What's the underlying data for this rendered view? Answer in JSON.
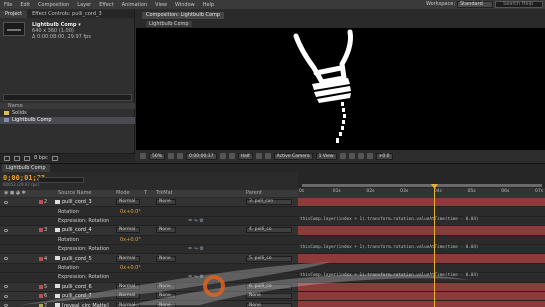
{
  "menu": [
    "File",
    "Edit",
    "Composition",
    "Layer",
    "Effect",
    "Animation",
    "View",
    "Window",
    "Help"
  ],
  "workspace": {
    "label": "Workspace:",
    "value": "Standard"
  },
  "search": {
    "placeholder": "Search Help"
  },
  "project": {
    "tabs": [
      "Project",
      "Effect Controls: pulli_cord_3"
    ],
    "item_title": "Lightbulb Comp ▾",
    "item_lines": [
      "640 x 360 (1.00)",
      "Δ 0:00:08:00, 29.97 fps"
    ],
    "header": "Name",
    "items": [
      {
        "name": "Solids",
        "color": "#d8c060"
      },
      {
        "name": "Lightbulb Comp",
        "color": "#8a8ab0"
      }
    ],
    "bpc": "8 bpc"
  },
  "viewer": {
    "tab": "Composition: Lightbulb Comp",
    "crumb": "Lightbulb Comp",
    "toolbar": [
      "50%",
      "0:00:00:17",
      "Half",
      "Active Camera",
      "1 View",
      "+0.0"
    ]
  },
  "timeline": {
    "tab": "Lightbulb Comp",
    "timecode": "0;00;01;23",
    "frames": "00053 (29.97 fps)",
    "columns": [
      "Source Name",
      "Mode",
      "T",
      "TrkMat",
      "Parent"
    ],
    "ruler": [
      "0s",
      "01s",
      "02s",
      "03s",
      "04s",
      "05s",
      "06s",
      "07s"
    ],
    "rows": [
      {
        "kind": "layer",
        "num": "2",
        "name": "pulli_cord_3",
        "mode": "Normal",
        "trk": "None",
        "parent": "3. pull_con",
        "label": "#c05050"
      },
      {
        "kind": "prop",
        "name": "Rotation",
        "value": "0x+0.0°"
      },
      {
        "kind": "expr",
        "name": "Expression: Rotation",
        "code": "thisComp.layer(index + 1).transform.rotation.valueAtTime(time - 0.04)"
      },
      {
        "kind": "layer",
        "num": "3",
        "name": "pulli_cord_4",
        "mode": "Normal",
        "trk": "None",
        "parent": "4. pulli_co",
        "label": "#c05050"
      },
      {
        "kind": "prop",
        "name": "Rotation",
        "value": "0x+0.0°"
      },
      {
        "kind": "expr",
        "name": "Expression: Rotation",
        "code": "thisComp.layer(index + 1).transform.rotation.valueAtTime(time - 0.04)"
      },
      {
        "kind": "layer",
        "num": "4",
        "name": "pulli_cord_5",
        "mode": "Normal",
        "trk": "None",
        "parent": "5. pulli_co",
        "label": "#c05050"
      },
      {
        "kind": "prop",
        "name": "Rotation",
        "value": "0x+0.0°"
      },
      {
        "kind": "expr",
        "name": "Expression: Rotation",
        "code": "thisComp.layer(index + 1).transform.rotation.valueAtTime(time - 0.04)"
      },
      {
        "kind": "layer",
        "num": "5",
        "name": "pulli_cord_6",
        "mode": "Normal",
        "trk": "None",
        "parent": "6. pulli_co",
        "label": "#c05050"
      },
      {
        "kind": "layer",
        "num": "6",
        "name": "pulli_cord_7",
        "mode": "Normal",
        "trk": "None",
        "parent": "None",
        "label": "#c05050"
      },
      {
        "kind": "layer",
        "num": "7",
        "name": "[reveal_circ Matte]",
        "mode": "Normal",
        "trk": "None",
        "parent": "None",
        "label": "#b0b050"
      }
    ]
  },
  "colors": {
    "accent": "#e8b030",
    "layer_bar": "#8c3a3a"
  }
}
